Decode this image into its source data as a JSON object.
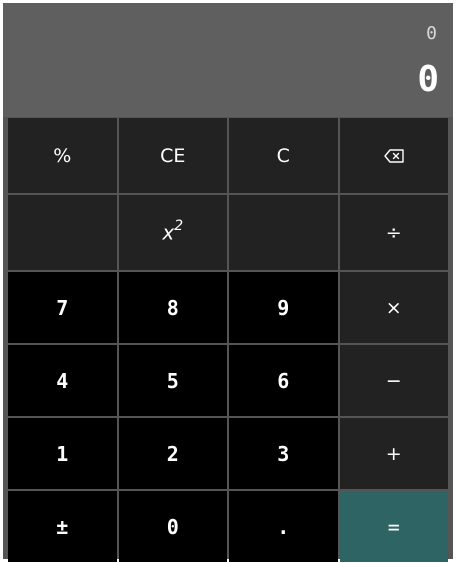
{
  "display": {
    "expression": "0",
    "result": "0"
  },
  "keys": {
    "percent": "%",
    "clear_entry": "CE",
    "clear": "C",
    "square_base": "x",
    "square_exp": "2",
    "divide": "÷",
    "seven": "7",
    "eight": "8",
    "nine": "9",
    "multiply": "×",
    "four": "4",
    "five": "5",
    "six": "6",
    "subtract": "−",
    "one": "1",
    "two": "2",
    "three": "3",
    "add": "+",
    "plus_minus": "±",
    "zero": "0",
    "decimal": ".",
    "equals": "="
  },
  "colors": {
    "display_bg": "#5f5f5f",
    "function_key_bg": "#222222",
    "number_key_bg": "#000000",
    "equals_key_bg": "#2e6464"
  },
  "icons": {
    "backspace": "backspace-icon"
  }
}
